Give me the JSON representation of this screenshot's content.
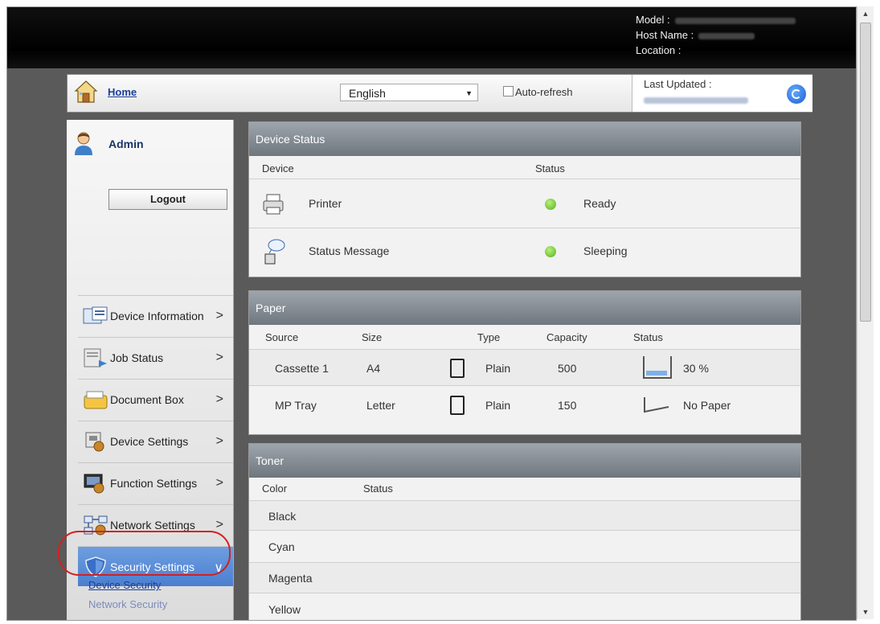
{
  "header": {
    "model_label": "Model :",
    "host_label": "Host Name :",
    "location_label": "Location :"
  },
  "toolbar": {
    "home_label": "Home",
    "language": "English",
    "auto_refresh_label": "Auto-refresh",
    "last_updated_label": "Last Updated :"
  },
  "sidebar": {
    "user_name": "Admin",
    "logout_label": "Logout",
    "items": [
      {
        "label": "Device Information",
        "icon": "device-information-icon"
      },
      {
        "label": "Job Status",
        "icon": "job-status-icon"
      },
      {
        "label": "Document Box",
        "icon": "document-box-icon"
      },
      {
        "label": "Device Settings",
        "icon": "device-settings-icon"
      },
      {
        "label": "Function Settings",
        "icon": "function-settings-icon"
      },
      {
        "label": "Network Settings",
        "icon": "network-settings-icon"
      },
      {
        "label": "Security Settings",
        "icon": "shield-icon"
      }
    ],
    "sub_items": [
      "Device Security",
      "Network Security"
    ]
  },
  "device_status": {
    "title": "Device Status",
    "col_device": "Device",
    "col_status": "Status",
    "rows": [
      {
        "device": "Printer",
        "status": "Ready"
      },
      {
        "device": "Status Message",
        "status": "Sleeping"
      }
    ]
  },
  "paper": {
    "title": "Paper",
    "cols": [
      "Source",
      "Size",
      "Type",
      "Capacity",
      "Status"
    ],
    "rows": [
      {
        "source": "Cassette 1",
        "size": "A4",
        "type": "Plain",
        "capacity": "500",
        "status": "30 %",
        "fill": 0.3
      },
      {
        "source": "MP Tray",
        "size": "Letter",
        "type": "Plain",
        "capacity": "150",
        "status": "No Paper",
        "fill": 0
      }
    ]
  },
  "toner": {
    "title": "Toner",
    "col_color": "Color",
    "col_status": "Status",
    "rows": [
      "Black",
      "Cyan",
      "Magenta",
      "Yellow"
    ]
  },
  "colors": {
    "accent": "#4b7fcf",
    "highlight_ring": "#d42020",
    "status_ok": "#58b020",
    "link": "#1a3e9a"
  }
}
